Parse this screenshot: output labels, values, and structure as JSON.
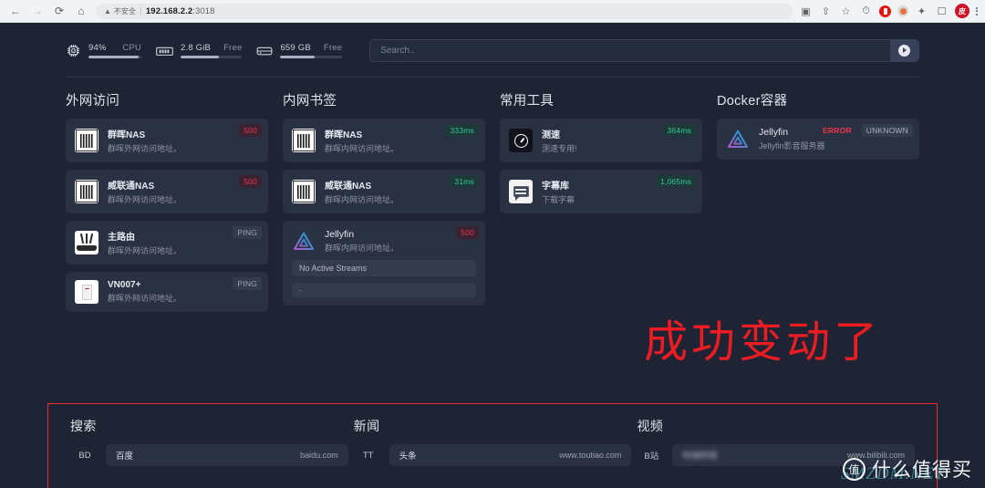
{
  "browser": {
    "back_icon": "←",
    "forward_icon": "→",
    "reload_icon": "⟳",
    "home_icon": "⌂",
    "security_warning": "不安全",
    "url_host": "192.168.2.2",
    "url_port": ":3018",
    "icons": [
      "translate-icon",
      "share-icon",
      "bookmark-star-icon",
      "speedometer-extension-icon",
      "opera-extension-icon",
      "circle-extension-icon",
      "puzzle-extension-icon",
      "sidepanel-icon",
      "profile-avatar",
      "kebab-menu-icon"
    ],
    "profile_initial": "皮"
  },
  "topbar": {
    "widgets": [
      {
        "icon": "cpu-icon",
        "value": "94%",
        "label": "CPU",
        "percent": 94
      },
      {
        "icon": "memory-icon",
        "value": "2.8 GiB",
        "label": "Free",
        "percent": 62
      },
      {
        "icon": "disk-icon",
        "value": "659 GB",
        "label": "Free",
        "percent": 55
      }
    ],
    "search": {
      "placeholder": "Search..",
      "value": "",
      "button_icon": "duckduckgo-icon"
    }
  },
  "columns": [
    {
      "title": "外网访问",
      "items": [
        {
          "name": "群晖NAS",
          "desc": "群晖外网访问地址。",
          "icon": "nas-icon",
          "badges": [
            {
              "text": "500",
              "style": "err"
            }
          ]
        },
        {
          "name": "威联通NAS",
          "desc": "群晖外网访问地址。",
          "icon": "nas-icon",
          "badges": [
            {
              "text": "500",
              "style": "err"
            }
          ]
        },
        {
          "name": "主路由",
          "desc": "群晖外网访问地址。",
          "icon": "router-icon",
          "badges": [
            {
              "text": "PING",
              "style": "ping"
            }
          ]
        },
        {
          "name": "VN007+",
          "desc": "群晖外网访问地址。",
          "icon": "modem-icon",
          "badges": [
            {
              "text": "PING",
              "style": "ping"
            }
          ]
        }
      ]
    },
    {
      "title": "内网书签",
      "items": [
        {
          "name": "群晖NAS",
          "desc": "群晖内网访问地址。",
          "icon": "nas-icon",
          "badges": [
            {
              "text": "333ms",
              "style": "ok"
            }
          ]
        },
        {
          "name": "威联通NAS",
          "desc": "群晖内网访问地址。",
          "icon": "nas-icon",
          "badges": [
            {
              "text": "31ms",
              "style": "ok"
            }
          ]
        },
        {
          "name": "Jellyfin",
          "desc": "群晖内网访问地址。",
          "icon": "jellyfin-icon",
          "thin": true,
          "badges": [
            {
              "text": "500",
              "style": "err"
            }
          ],
          "substats": [
            {
              "text": "No Active Streams",
              "small": false
            },
            {
              "text": "-",
              "small": true
            }
          ]
        }
      ]
    },
    {
      "title": "常用工具",
      "items": [
        {
          "name": "测速",
          "desc": "测速专用!",
          "icon": "speedtest-icon",
          "badges": [
            {
              "text": "364ms",
              "style": "ok"
            }
          ]
        },
        {
          "name": "字幕库",
          "desc": "下载字幕",
          "icon": "subtitle-icon",
          "badges": [
            {
              "text": "1,065ms",
              "style": "ok"
            }
          ]
        }
      ]
    },
    {
      "title": "Docker容器",
      "items": [
        {
          "name": "Jellyfin",
          "desc": "Jellyfin影音服务器",
          "icon": "jellyfin-icon",
          "thin": true,
          "badges": [
            {
              "text": "ERROR",
              "style": "error-text"
            },
            {
              "text": "UNKNOWN",
              "style": "unknown"
            }
          ]
        }
      ]
    }
  ],
  "annotation": {
    "text": "成功变动了",
    "color": "#ec1c22"
  },
  "bookmarks": {
    "highlight_color": "#ef2b2b",
    "groups": [
      {
        "title": "搜索",
        "items": [
          {
            "abbr": "BD",
            "name": "百度",
            "url": "baidu.com",
            "blurred": false
          }
        ]
      },
      {
        "title": "新闻",
        "items": [
          {
            "abbr": "TT",
            "name": "头条",
            "url": "www.toutiao.com",
            "blurred": false
          }
        ]
      },
      {
        "title": "视频",
        "items": [
          {
            "abbr": "B站",
            "name": "哔哩哔哩",
            "url": "www.bilibili.com",
            "blurred": true
          }
        ]
      }
    ]
  },
  "watermark": {
    "badge": "值",
    "text": "什么值得买",
    "secondary": "SMZDM.NET"
  }
}
